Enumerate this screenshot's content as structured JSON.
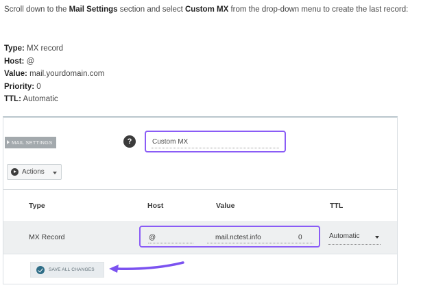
{
  "intro": {
    "p1": "Scroll down to the ",
    "b1": "Mail Settings",
    "p2": " section and select ",
    "b2": "Custom MX",
    "p3": " from the drop-down menu to create the last record:"
  },
  "record": [
    {
      "label": "Type:",
      "value": "MX record"
    },
    {
      "label": "Host:",
      "value": "@"
    },
    {
      "label": "Value:",
      "value": "mail.yourdomain.com"
    },
    {
      "label": "Priority:",
      "value": "0"
    },
    {
      "label": "TTL:",
      "value": "Automatic"
    }
  ],
  "panel": {
    "section_tag": "MAIL SETTINGS",
    "help_icon": "?",
    "mail_setting_value": "Custom MX",
    "actions_label": "Actions",
    "columns": [
      "Type",
      "Host",
      "Value",
      "TTL"
    ],
    "row": {
      "type": "MX Record",
      "host": "@",
      "value": "mail.nctest.info",
      "priority": "0",
      "ttl": "Automatic"
    },
    "save_label": "SAVE ALL CHANGES"
  },
  "colors": {
    "highlight": "#8a5cf6",
    "arrow": "#7b52f0"
  },
  "icons": {
    "help": "question-circle-icon",
    "actions": "play-circle-icon",
    "dropdown": "caret-down-icon",
    "save": "check-circle-icon",
    "annotation": "arrow-left-icon"
  }
}
